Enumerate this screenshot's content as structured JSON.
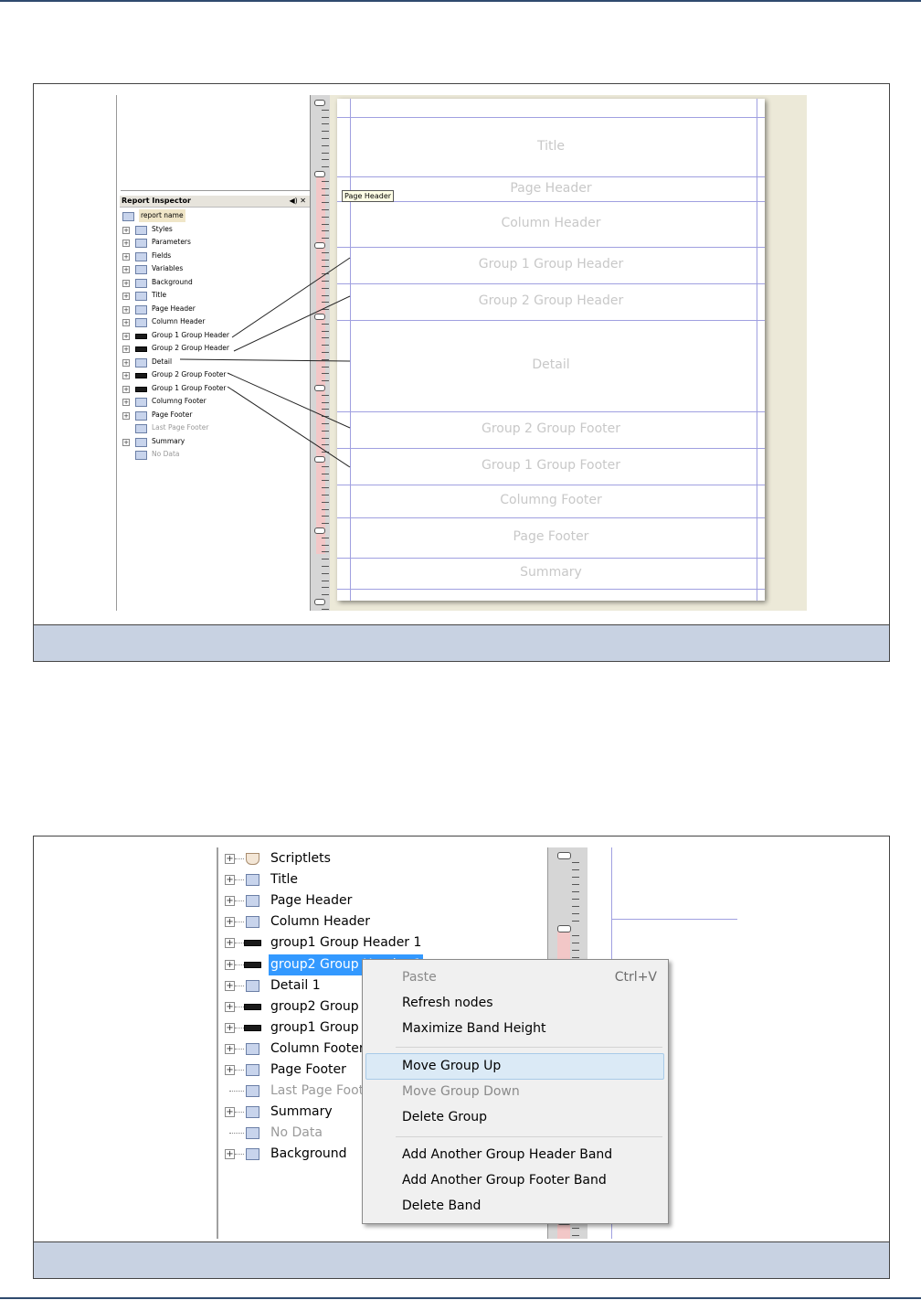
{
  "figure1": {
    "inspector_title": "Report Inspector",
    "inspector_buttons": "◀) ✕",
    "tooltip": "Page Header",
    "tree": [
      {
        "label": "report name",
        "expander": "",
        "icon": "report",
        "root": true
      },
      {
        "label": "Styles",
        "expander": "+",
        "icon": "styles"
      },
      {
        "label": "Parameters",
        "expander": "+",
        "icon": "parameters"
      },
      {
        "label": "Fields",
        "expander": "+",
        "icon": "fields"
      },
      {
        "label": "Variables",
        "expander": "+",
        "icon": "variables"
      },
      {
        "label": "Background",
        "expander": "+",
        "icon": "band"
      },
      {
        "label": "Title",
        "expander": "+",
        "icon": "band"
      },
      {
        "label": "Page Header",
        "expander": "+",
        "icon": "band"
      },
      {
        "label": "Column Header",
        "expander": "+",
        "icon": "band"
      },
      {
        "label": "Group 1 Group Header",
        "expander": "+",
        "icon": "group"
      },
      {
        "label": "Group 2 Group Header",
        "expander": "+",
        "icon": "group"
      },
      {
        "label": "Detail",
        "expander": "+",
        "icon": "band"
      },
      {
        "label": "Group 2 Group Footer",
        "expander": "+",
        "icon": "group"
      },
      {
        "label": "Group 1 Group Footer",
        "expander": "+",
        "icon": "group"
      },
      {
        "label": "Columng Footer",
        "expander": "+",
        "icon": "band"
      },
      {
        "label": "Page Footer",
        "expander": "+",
        "icon": "band"
      },
      {
        "label": "Last Page Footer",
        "expander": "",
        "icon": "band",
        "disabled": true
      },
      {
        "label": "Summary",
        "expander": "+",
        "icon": "band"
      },
      {
        "label": "No Data",
        "expander": "",
        "icon": "band",
        "disabled": true
      }
    ],
    "bands": [
      "Title",
      "Page Header",
      "Column Header",
      "Group 1 Group Header",
      "Group 2 Group Header",
      "Detail",
      "Group 2 Group Footer",
      "Group 1 Group Footer",
      "Columng Footer",
      "Page Footer",
      "Summary"
    ]
  },
  "figure2": {
    "tree": [
      {
        "label": "Scriptlets",
        "icon": "scriptlets-icon"
      },
      {
        "label": "Title",
        "icon": "band-icon"
      },
      {
        "label": "Page Header",
        "icon": "band-icon"
      },
      {
        "label": "Column Header",
        "icon": "band-icon"
      },
      {
        "label": "group1 Group Header  1",
        "icon": "group-band-icon"
      },
      {
        "label": "group2 Group Header  1",
        "icon": "group-band-icon",
        "selected": true
      },
      {
        "label": "Detail  1",
        "icon": "band-icon"
      },
      {
        "label": "group2 Group Footer  1",
        "icon": "group-band-icon"
      },
      {
        "label": "group1 Group Footer  1",
        "icon": "group-band-icon"
      },
      {
        "label": "Column Footer",
        "icon": "band-icon"
      },
      {
        "label": "Page Footer",
        "icon": "band-icon"
      },
      {
        "label": "Last Page Footer",
        "icon": "band-icon",
        "disabled": true,
        "leaf": true
      },
      {
        "label": "Summary",
        "icon": "band-icon"
      },
      {
        "label": "No Data",
        "icon": "band-icon",
        "disabled": true,
        "leaf": true
      },
      {
        "label": "Background",
        "icon": "band-icon"
      }
    ],
    "context_menu": {
      "paste": "Paste",
      "paste_shortcut": "Ctrl+V",
      "refresh": "Refresh nodes",
      "maximize": "Maximize Band Height",
      "move_up": "Move Group Up",
      "move_down": "Move Group Down",
      "delete_group": "Delete Group",
      "add_header": "Add Another Group Header Band",
      "add_footer": "Add Another Group Footer Band",
      "delete_band": "Delete Band"
    }
  }
}
